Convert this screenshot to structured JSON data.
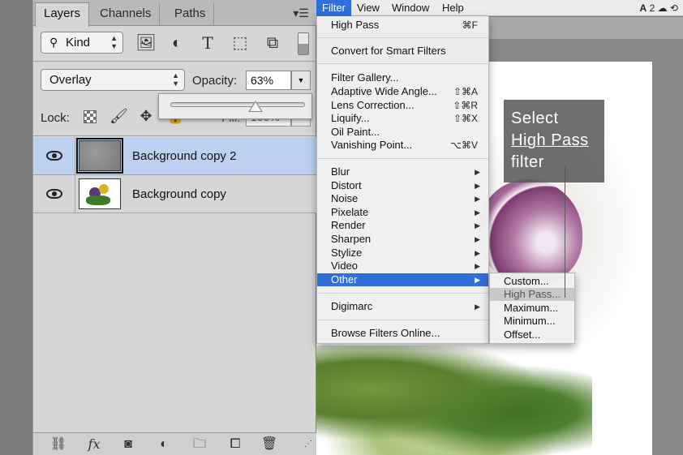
{
  "layers_panel": {
    "tabs": [
      "Layers",
      "Channels",
      "Paths"
    ],
    "filter_kind": "Kind",
    "blend_mode": "Overlay",
    "opacity_label": "Opacity:",
    "opacity_value": "63%",
    "opacity_slider_fraction": 0.63,
    "lock_label": "Lock:",
    "fill_label": "Fill:",
    "fill_value": "100%",
    "layers": [
      {
        "name": "Background copy 2",
        "selected": true
      },
      {
        "name": "Background copy",
        "selected": false
      }
    ]
  },
  "menubar": {
    "items": [
      "Filter",
      "View",
      "Window",
      "Help"
    ],
    "active": "Filter",
    "status_text": "2"
  },
  "filter_menu": {
    "items": [
      {
        "label": "High Pass",
        "shortcut": "⌘F"
      },
      {
        "label": "Convert for Smart Filters"
      },
      {
        "label": "Filter Gallery..."
      },
      {
        "label": "Adaptive Wide Angle...",
        "shortcut": "⇧⌘A"
      },
      {
        "label": "Lens Correction...",
        "shortcut": "⇧⌘R"
      },
      {
        "label": "Liquify...",
        "shortcut": "⇧⌘X"
      },
      {
        "label": "Oil Paint..."
      },
      {
        "label": "Vanishing Point...",
        "shortcut": "⌥⌘V"
      },
      {
        "label": "Blur"
      },
      {
        "label": "Distort"
      },
      {
        "label": "Noise"
      },
      {
        "label": "Pixelate"
      },
      {
        "label": "Render"
      },
      {
        "label": "Sharpen"
      },
      {
        "label": "Stylize"
      },
      {
        "label": "Video"
      },
      {
        "label": "Other"
      },
      {
        "label": "Digimarc"
      },
      {
        "label": "Browse Filters Online..."
      }
    ]
  },
  "other_submenu": {
    "items": [
      "Custom...",
      "High Pass...",
      "Maximum...",
      "Minimum...",
      "Offset..."
    ]
  },
  "callout": {
    "line1": "Select",
    "line2": "High Pass",
    "line3": "filter"
  },
  "colors": {
    "menu_highlight": "#2e6fd9",
    "layer_selected": "#bcd0f2"
  }
}
